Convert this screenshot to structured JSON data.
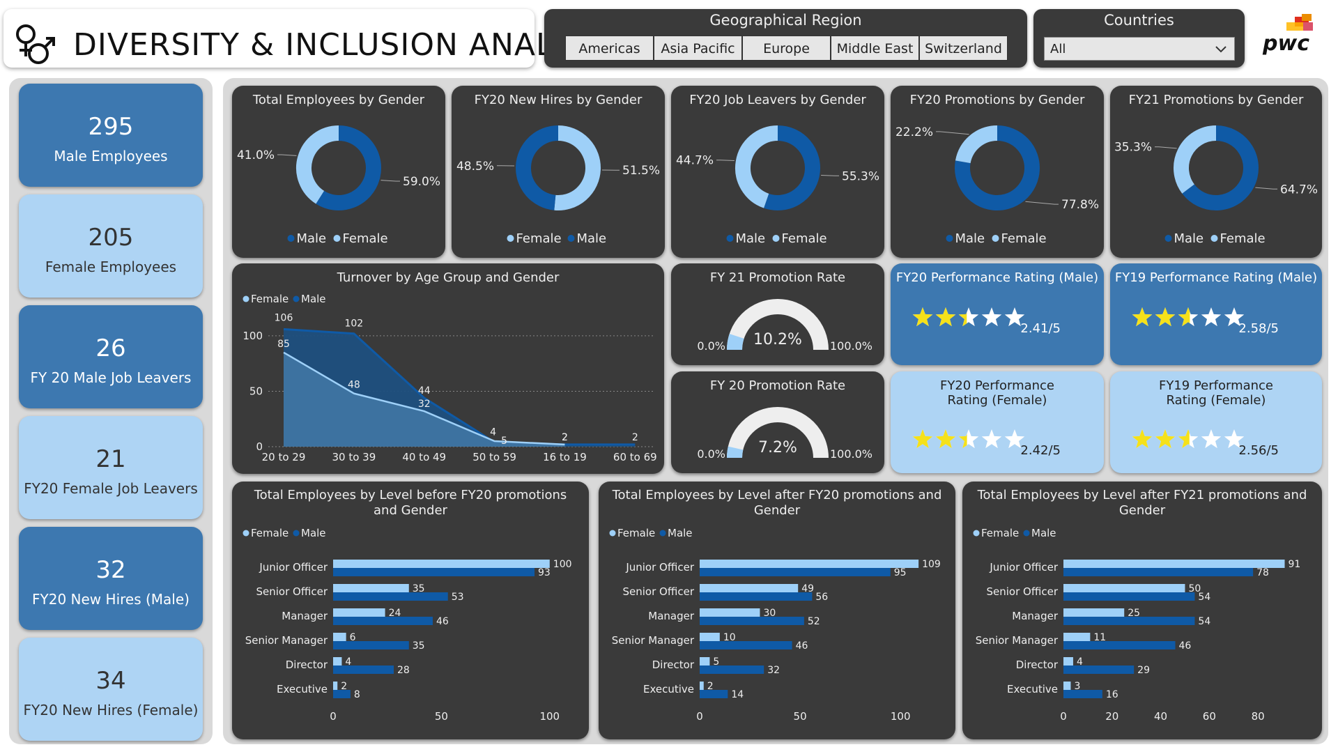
{
  "header": {
    "title": "DIVERSITY & INCLUSION ANALYSIS"
  },
  "colors": {
    "male": "#0f5aa6",
    "female": "#9ed0f8",
    "panel": "#3a3a3a",
    "kpi_dark": "#3d78b0",
    "kpi_light": "#aed4f4",
    "star": "#f5e11a"
  },
  "geo": {
    "title": "Geographical Region",
    "buttons": [
      "Americas",
      "Asia Pacific",
      "Europe",
      "Middle East",
      "Switzerland"
    ]
  },
  "countries": {
    "title": "Countries",
    "selected": "All"
  },
  "logo": {
    "text": "pwc"
  },
  "kpis": [
    {
      "value": "295",
      "label": "Male Employees"
    },
    {
      "value": "205",
      "label": "Female Employees"
    },
    {
      "value": "26",
      "label": "FY 20 Male Job Leavers"
    },
    {
      "value": "21",
      "label": "FY20 Female Job Leavers"
    },
    {
      "value": "32",
      "label": "FY20 New Hires (Male)"
    },
    {
      "value": "34",
      "label": "FY20 New Hires (Female)"
    }
  ],
  "gauges": [
    {
      "title": "FY 21 Promotion Rate",
      "value": 10.2,
      "value_label": "10.2%",
      "min_label": "0.0%",
      "max_label": "100.0%"
    },
    {
      "title": "FY 20 Promotion Rate",
      "value": 7.2,
      "value_label": "7.2%",
      "min_label": "0.0%",
      "max_label": "100.0%"
    }
  ],
  "ratings": [
    {
      "title": "FY20 Performance Rating (Male)",
      "rating": 2.41,
      "label": "2.41/5"
    },
    {
      "title": "FY19 Performance Rating (Male)",
      "rating": 2.58,
      "label": "2.58/5"
    },
    {
      "title": "FY20 Performance Rating (Female)",
      "rating": 2.42,
      "label": "2.42/5"
    },
    {
      "title": "FY19 Performance Rating (Female)",
      "rating": 2.56,
      "label": "2.56/5"
    }
  ],
  "chart_data": [
    {
      "type": "pie",
      "title": "Total Employees by Gender",
      "legend": [
        "Male",
        "Female"
      ],
      "slices": [
        {
          "name": "Male",
          "value": 59.0,
          "label": "59.0%"
        },
        {
          "name": "Female",
          "value": 41.0,
          "label": "41.0%"
        }
      ]
    },
    {
      "type": "pie",
      "title": "FY20 New Hires by Gender",
      "legend": [
        "Female",
        "Male"
      ],
      "slices": [
        {
          "name": "Female",
          "value": 51.5,
          "label": "51.5%"
        },
        {
          "name": "Male",
          "value": 48.5,
          "label": "48.5%"
        }
      ]
    },
    {
      "type": "pie",
      "title": "FY20 Job Leavers by Gender",
      "legend": [
        "Male",
        "Female"
      ],
      "slices": [
        {
          "name": "Male",
          "value": 55.3,
          "label": "55.3%"
        },
        {
          "name": "Female",
          "value": 44.7,
          "label": "44.7%"
        }
      ]
    },
    {
      "type": "pie",
      "title": "FY20 Promotions by Gender",
      "legend": [
        "Male",
        "Female"
      ],
      "slices": [
        {
          "name": "Male",
          "value": 77.8,
          "label": "77.8%"
        },
        {
          "name": "Female",
          "value": 22.2,
          "label": "22.2%"
        }
      ]
    },
    {
      "type": "pie",
      "title": "FY21 Promotions by Gender",
      "legend": [
        "Male",
        "Female"
      ],
      "slices": [
        {
          "name": "Male",
          "value": 64.7,
          "label": "64.7%"
        },
        {
          "name": "Female",
          "value": 35.3,
          "label": "35.3%"
        }
      ]
    },
    {
      "type": "area",
      "title": "Turnover by Age Group and Gender",
      "legend": [
        "Female",
        "Male"
      ],
      "categories": [
        "20 to 29",
        "30 to 39",
        "40 to 49",
        "50 to 59",
        "16 to 19",
        "60 to 69"
      ],
      "series": [
        {
          "name": "Female",
          "values": [
            85,
            48,
            32,
            5,
            2,
            null
          ]
        },
        {
          "name": "Male",
          "values": [
            106,
            102,
            44,
            4,
            2,
            2
          ]
        }
      ],
      "yticks": [
        0,
        50,
        100
      ],
      "ylim": [
        0,
        110
      ]
    },
    {
      "type": "bar",
      "title": "Total Employees by Level before FY20 promotions and Gender",
      "legend": [
        "Female",
        "Male"
      ],
      "categories": [
        "Junior Officer",
        "Senior Officer",
        "Manager",
        "Senior Manager",
        "Director",
        "Executive"
      ],
      "series": [
        {
          "name": "Female",
          "values": [
            100,
            35,
            24,
            6,
            4,
            2
          ]
        },
        {
          "name": "Male",
          "values": [
            93,
            53,
            46,
            35,
            28,
            8
          ]
        }
      ],
      "xticks": [
        0,
        50,
        100
      ],
      "xlim": [
        0,
        102
      ]
    },
    {
      "type": "bar",
      "title": "Total Employees by Level after FY20 promotions and Gender",
      "legend": [
        "Female",
        "Male"
      ],
      "categories": [
        "Junior Officer",
        "Senior Officer",
        "Manager",
        "Senior Manager",
        "Director",
        "Executive"
      ],
      "series": [
        {
          "name": "Female",
          "values": [
            109,
            49,
            30,
            10,
            5,
            2
          ]
        },
        {
          "name": "Male",
          "values": [
            95,
            56,
            52,
            46,
            32,
            14
          ]
        }
      ],
      "xticks": [
        0,
        50,
        100
      ],
      "xlim": [
        0,
        110
      ]
    },
    {
      "type": "bar",
      "title": "Total Employees by Level after FY21 promotions and Gender",
      "legend": [
        "Female",
        "Male"
      ],
      "categories": [
        "Junior Officer",
        "Senior Officer",
        "Manager",
        "Senior Manager",
        "Director",
        "Executive"
      ],
      "series": [
        {
          "name": "Female",
          "values": [
            91,
            50,
            25,
            11,
            4,
            3
          ]
        },
        {
          "name": "Male",
          "values": [
            78,
            54,
            54,
            46,
            29,
            16
          ]
        }
      ],
      "xticks": [
        0,
        20,
        40,
        60,
        80
      ],
      "xlim": [
        0,
        92
      ]
    }
  ]
}
